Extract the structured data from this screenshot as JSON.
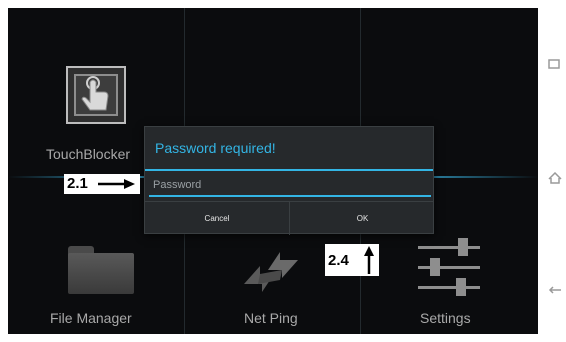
{
  "apps": [
    {
      "label": "TouchBlocker",
      "icon": "hand-pointer-icon"
    },
    {
      "label": "File Manager",
      "icon": "folder-icon"
    },
    {
      "label": "Net Ping",
      "icon": "arrows-icon"
    },
    {
      "label": "Settings",
      "icon": "sliders-icon"
    }
  ],
  "dialog": {
    "title": "Password required!",
    "password_placeholder": "Password",
    "cancel_label": "Cancel",
    "ok_label": "OK"
  },
  "annotations": {
    "step_a": "2.1",
    "step_b": "2.4"
  },
  "navbar": {
    "icons": [
      "recent-apps-icon",
      "home-icon",
      "back-icon"
    ]
  },
  "colors": {
    "accent": "#33b5e5",
    "dialog_bg": "#26292c",
    "screen_bg": "#0b0c0e"
  }
}
